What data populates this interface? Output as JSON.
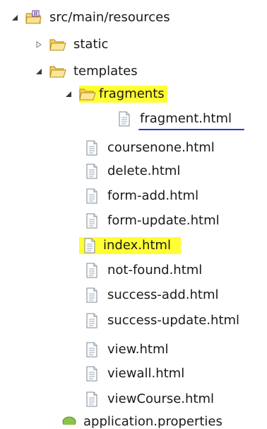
{
  "tree": {
    "root": {
      "label": "src/main/resources",
      "toggle": "expanded",
      "icon": "package-folder-icon"
    },
    "static": {
      "label": "static",
      "toggle": "collapsed",
      "icon": "folder-icon"
    },
    "templates": {
      "label": "templates",
      "toggle": "expanded",
      "icon": "folder-open-icon"
    },
    "fragments": {
      "label": "fragments",
      "toggle": "expanded",
      "icon": "folder-open-icon",
      "highlight": "#ffff33"
    },
    "fragment_file": {
      "label": "fragment.html",
      "icon": "html-file-icon",
      "underline": "#1f3fbf"
    },
    "files": [
      {
        "label": "coursenone.html",
        "icon": "html-file-icon"
      },
      {
        "label": "delete.html",
        "icon": "html-file-icon"
      },
      {
        "label": "form-add.html",
        "icon": "html-file-icon"
      },
      {
        "label": "form-update.html",
        "icon": "html-file-icon"
      },
      {
        "label": "index.html",
        "icon": "html-file-icon",
        "highlight": "#ffff33"
      },
      {
        "label": "not-found.html",
        "icon": "html-file-icon"
      },
      {
        "label": "success-add.html",
        "icon": "html-file-icon"
      },
      {
        "label": "success-update.html",
        "icon": "html-file-icon"
      },
      {
        "label": "view.html",
        "icon": "html-file-icon"
      },
      {
        "label": "viewall.html",
        "icon": "html-file-icon"
      },
      {
        "label": "viewCourse.html",
        "icon": "html-file-icon"
      }
    ],
    "partial": {
      "label": "application.properties",
      "icon": "properties-file-icon"
    }
  }
}
